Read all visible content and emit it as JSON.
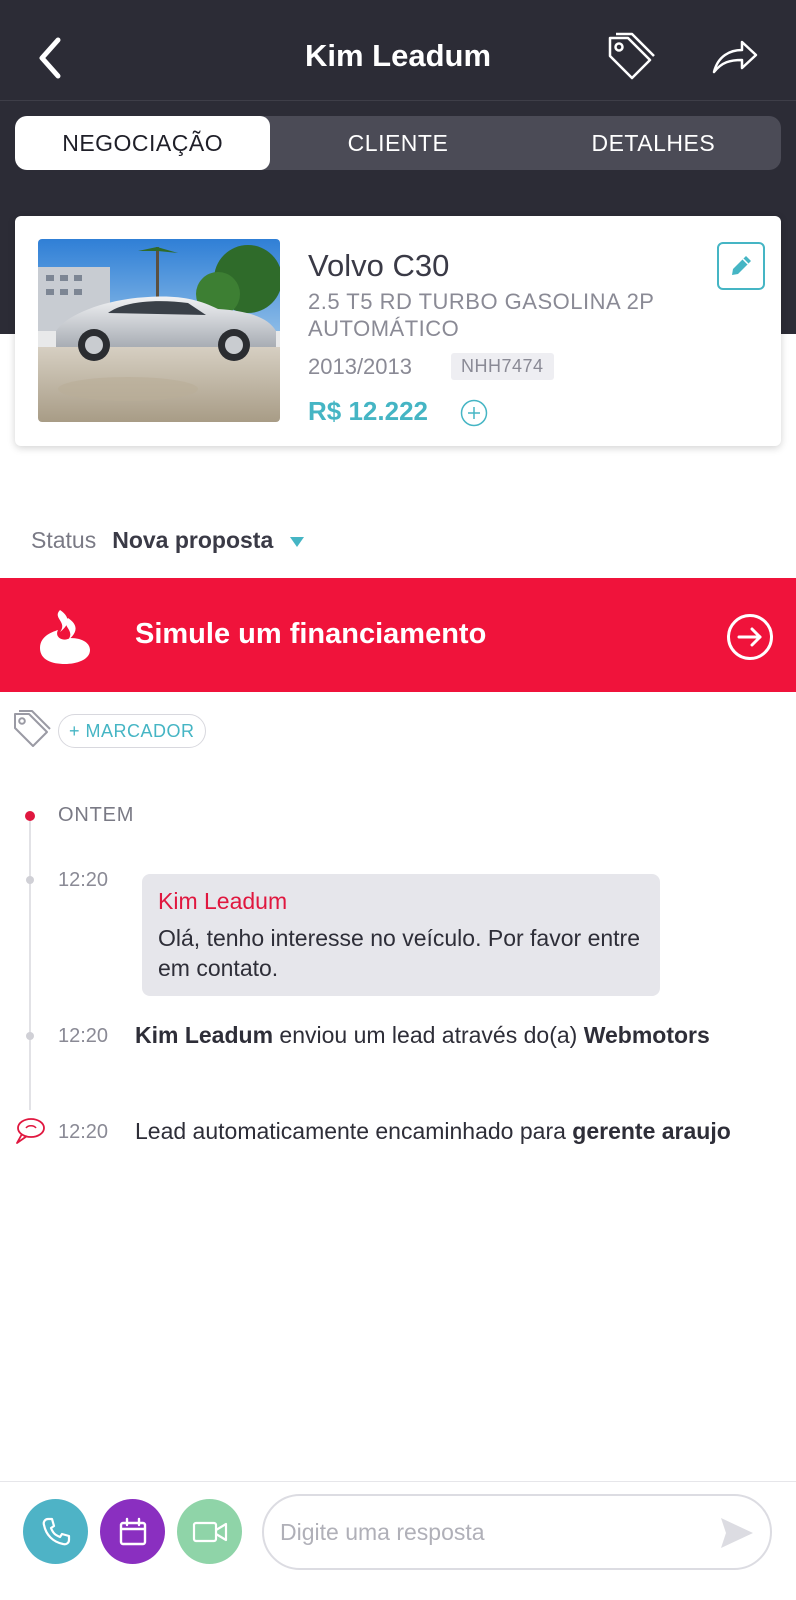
{
  "header": {
    "title": "Kim Leadum",
    "back_icon": "chevron-left-icon",
    "tag_icon": "tag-icon",
    "share_icon": "share-icon"
  },
  "tabs": [
    {
      "label": "NEGOCIAÇÃO",
      "active": true
    },
    {
      "label": "CLIENTE",
      "active": false
    },
    {
      "label": "DETALHES",
      "active": false
    }
  ],
  "vehicle": {
    "name": "Volvo C30",
    "version": "2.5 T5 RD TURBO GASOLINA 2P AUTOMÁTICO",
    "year": "2013/2013",
    "plate": "NHH7474",
    "price": "R$ 12.222"
  },
  "status": {
    "label": "Status",
    "value": "Nova proposta"
  },
  "finance_banner": {
    "text": "Simule um financiamento",
    "color": "#f0133b"
  },
  "markers": {
    "add_label": "+ MARCADOR"
  },
  "timeline": {
    "day_label": "ONTEM",
    "message": {
      "time": "12:20",
      "author": "Kim Leadum",
      "text": "Olá, tenho interesse no veículo. Por favor entre em contato."
    },
    "event1": {
      "time": "12:20",
      "name": "Kim Leadum",
      "text": " enviou um lead através do(a) ",
      "source": "Webmotors"
    },
    "event2": {
      "time": "12:20",
      "text": "Lead automaticamente encaminhado para ",
      "target": "gerente araujo"
    }
  },
  "footer": {
    "reply_placeholder": "Digite uma resposta",
    "buttons": [
      {
        "icon": "phone-icon",
        "color": "#4eb3c6"
      },
      {
        "icon": "calendar-icon",
        "color": "#8a2fc0"
      },
      {
        "icon": "video-icon",
        "color": "#8fd4a8"
      }
    ]
  },
  "colors": {
    "accent": "#45b5c4",
    "header_bg": "#2c2c36",
    "alert_red": "#e0173f"
  }
}
